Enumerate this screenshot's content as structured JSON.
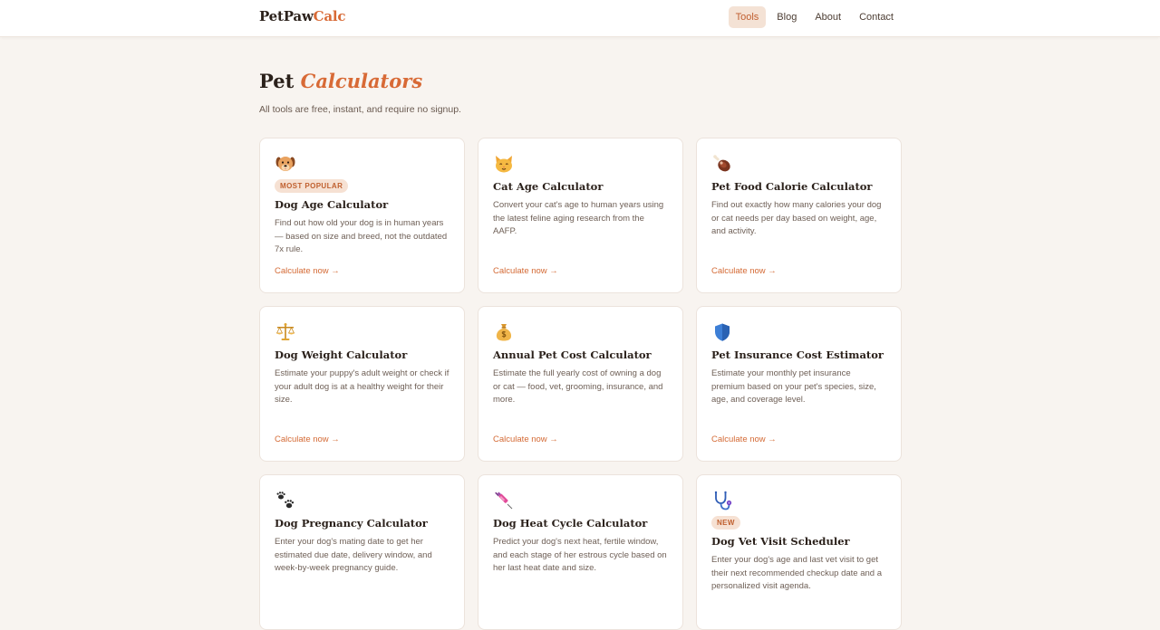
{
  "brand": {
    "name_part1": "PetPaw",
    "name_part2": "Calc"
  },
  "nav": {
    "items": [
      {
        "label": "Tools",
        "active": true
      },
      {
        "label": "Blog",
        "active": false
      },
      {
        "label": "About",
        "active": false
      },
      {
        "label": "Contact",
        "active": false
      }
    ]
  },
  "hero": {
    "title_part1": "Pet",
    "title_part2": "Calculators",
    "subtitle": "All tools are free, instant, and require no signup."
  },
  "cards": [
    {
      "icon": "dog-face-icon",
      "badge": "MOST POPULAR",
      "title": "Dog Age Calculator",
      "description": "Find out how old your dog is in human years — based on size and breed, not the outdated 7x rule.",
      "link": "Calculate now →"
    },
    {
      "icon": "cat-face-icon",
      "badge": "",
      "title": "Cat Age Calculator",
      "description": "Convert your cat's age to human years using the latest feline aging research from the AAFP.",
      "link": "Calculate now →"
    },
    {
      "icon": "meat-icon",
      "badge": "",
      "title": "Pet Food Calorie Calculator",
      "description": "Find out exactly how many calories your dog or cat needs per day based on weight, age, and activity.",
      "link": "Calculate now →"
    },
    {
      "icon": "scale-icon",
      "badge": "",
      "title": "Dog Weight Calculator",
      "description": "Estimate your puppy's adult weight or check if your adult dog is at a healthy weight for their size.",
      "link": "Calculate now →"
    },
    {
      "icon": "money-bag-icon",
      "badge": "",
      "title": "Annual Pet Cost Calculator",
      "description": "Estimate the full yearly cost of owning a dog or cat — food, vet, grooming, insurance, and more.",
      "link": "Calculate now →"
    },
    {
      "icon": "shield-icon",
      "badge": "",
      "title": "Pet Insurance Cost Estimator",
      "description": "Estimate your monthly pet insurance premium based on your pet's species, size, age, and coverage level.",
      "link": "Calculate now →"
    },
    {
      "icon": "paw-prints-icon",
      "badge": "",
      "title": "Dog Pregnancy Calculator",
      "description": "Enter your dog's mating date to get her estimated due date, delivery window, and week-by-week pregnancy guide.",
      "link": ""
    },
    {
      "icon": "syringe-icon",
      "badge": "",
      "title": "Dog Heat Cycle Calculator",
      "description": "Predict your dog's next heat, fertile window, and each stage of her estrous cycle based on her last heat date and size.",
      "link": ""
    },
    {
      "icon": "stethoscope-icon",
      "badge": "NEW",
      "title": "Dog Vet Visit Scheduler",
      "description": "Enter your dog's age and last vet visit to get their next recommended checkup date and a personalized visit agenda.",
      "link": ""
    }
  ]
}
